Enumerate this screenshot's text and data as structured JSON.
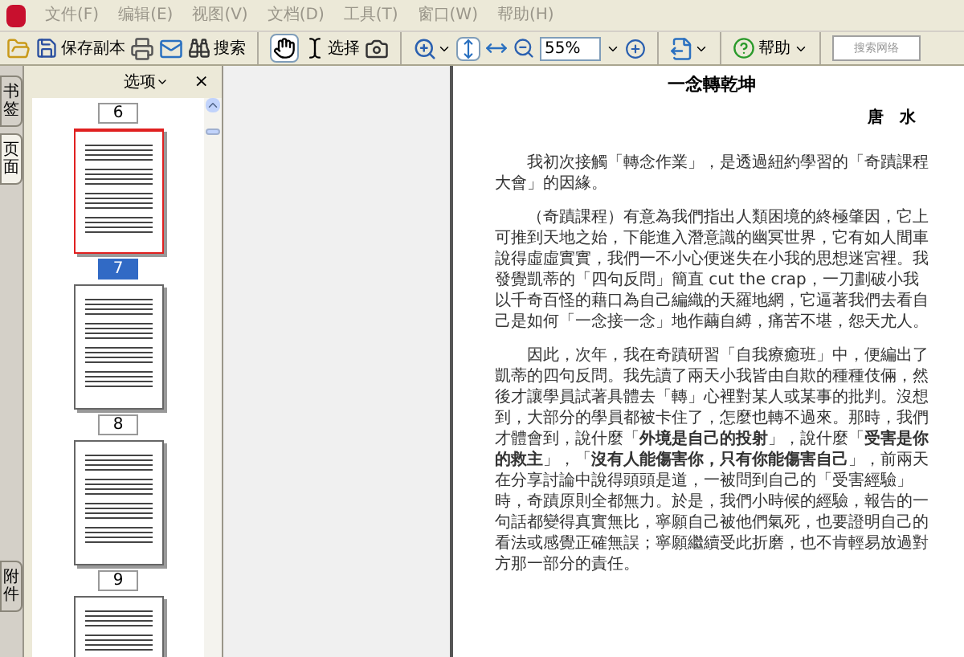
{
  "menu": [
    "文件(F)",
    "编辑(E)",
    "视图(V)",
    "文档(D)",
    "工具(T)",
    "窗口(W)",
    "帮助(H)"
  ],
  "toolbar": {
    "save_copy": "保存副本",
    "search": "搜索",
    "select": "选择",
    "hand_selected": true,
    "zoom": "55%",
    "help": "帮助",
    "web_search_placeholder": "搜索网络"
  },
  "side_tabs": [
    {
      "label": "书签",
      "selected": false
    },
    {
      "label": "页面",
      "selected": true
    },
    {
      "label": "附件",
      "selected": false
    }
  ],
  "thumbnail_panel": {
    "options": "选项",
    "close": "×",
    "first_label": "6",
    "thumbnails": [
      {
        "label": "7",
        "selected": true
      },
      {
        "label": "8",
        "selected": false
      },
      {
        "label": "9",
        "selected": false
      },
      {
        "selected": false
      }
    ]
  },
  "document": {
    "title": "一念轉乾坤",
    "author": "唐　水",
    "paragraphs": [
      "我初次接觸「轉念作業」，是透過紐約學習的「奇蹟課程大會」的因緣。",
      "（奇蹟課程）有意為我們指出人類困境的終極肇因，它上可推到天地之始，下能進入潛意識的幽冥世界，它有如人間車說得虛虛實實，我們一不小心便迷失在小我的思想迷宮裡。我發覺凱蒂的「四句反問」簡直 cut the crap，一刀劃破小我以千奇百怪的藉口為自己編織的天羅地網，它逼著我們去看自己是如何「一念接一念」地作繭自縛，痛苦不堪，怨天尤人。",
      "因此，次年，我在奇蹟研習「自我療癒班」中，便編出了凱蒂的四句反問。我先讀了兩天小我皆由自欺的種種伎倆，然後才讓學員試著具體去「轉」心裡對某人或某事的批判。沒想到，大部分的學員都被卡住了，怎麼也轉不過來。那時，我們才體會到，說什麼「**外境是自己的投射**」，說什麼「**受害是你的救主**」，「**沒有人能傷害你，只有你能傷害自己**」，前兩天在分享討論中說得頭頭是道，一被問到自己的「受害經驗」時，奇蹟原則全都無力。於是，我們小時候的經驗，報告的一句話都變得真實無比，寧願自己被他們氣死，也要證明自己的看法或感覺正確無誤；寧願繼續受此折磨，也不肯輕易放過對方那一部分的責任。"
    ]
  }
}
